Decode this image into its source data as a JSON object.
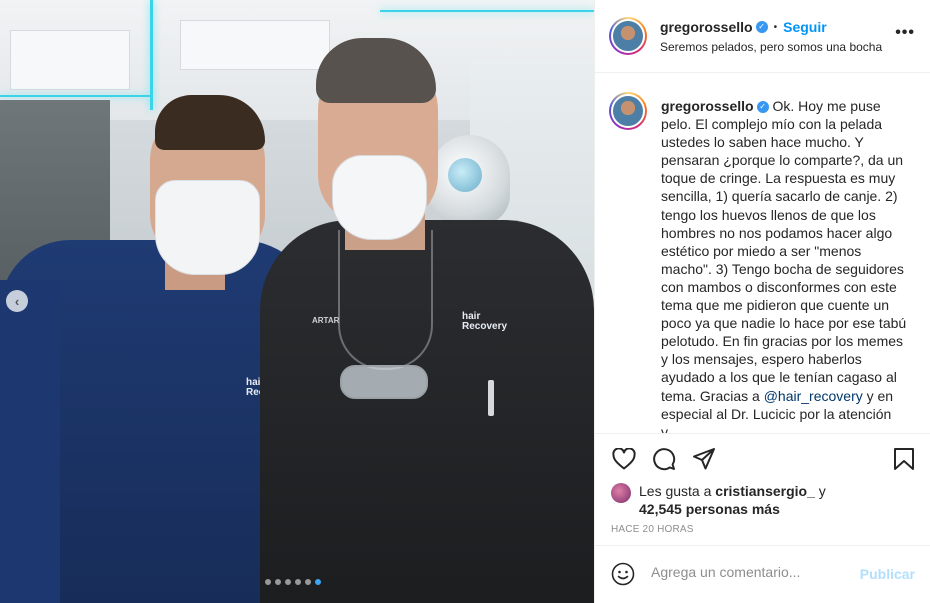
{
  "post": {
    "photo_label": "post photo",
    "carousel": {
      "total": 6,
      "active_index": 5
    },
    "logos": {
      "left": "hair Recovery",
      "right": "hair Recovery",
      "name_tag": "ARTAR"
    }
  },
  "header": {
    "username": "gregorossello",
    "separator": "•",
    "follow_label": "Seguir",
    "subtitle": "Seremos pelados, pero somos una bocha",
    "more_label": "•••"
  },
  "caption": {
    "username": "gregorossello",
    "text_1": "Ok. Hoy me puse pelo. El complejo mío con la pelada ustedes lo saben hace mucho. Y pensaran ¿porque lo comparte?, da un toque de cringe. La respuesta es muy sencilla, 1) quería sacarlo de canje. 2) tengo los huevos llenos de que los hombres no nos podamos hacer algo estético por miedo a ser \"menos macho\". 3) Tengo bocha de seguidores con mambos o disconformes con este tema que me pidieron que cuente un poco ya que nadie lo hace por ese tabú pelotudo. En fin gracias por los memes y los mensajes, espero haberlos ayudado a los que le tenían cagaso al tema. Gracias a ",
    "mention": "@hair_recovery",
    "text_2": " y en especial al Dr. Lucicic por la atención y..."
  },
  "likes": {
    "prefix": "Les gusta a ",
    "user": "cristiansergio_",
    "middle": " y",
    "count": "42,545 personas más"
  },
  "timestamp": "HACE 20 HORAS",
  "comment": {
    "placeholder": "Agrega un comentario...",
    "publish_label": "Publicar"
  },
  "icons": {
    "like": "heart-icon",
    "comment": "comment-icon",
    "share": "share-icon",
    "save": "bookmark-icon",
    "emoji": "emoji-icon",
    "verified": "verified-badge-icon"
  },
  "colors": {
    "link_blue": "#0095f6",
    "verified_blue": "#3897f0",
    "mention": "#00376b",
    "muted": "#8e8e8e",
    "publish_disabled": "#b2dffc"
  }
}
